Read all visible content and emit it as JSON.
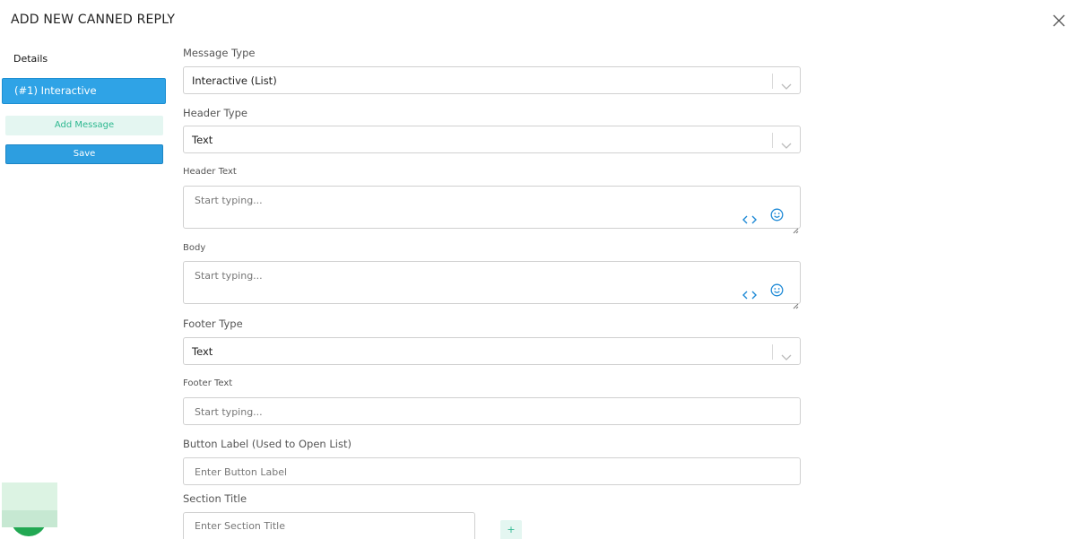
{
  "dialog": {
    "title": "ADD NEW CANNED REPLY"
  },
  "sidebar": {
    "details_label": "Details",
    "active_item": "(#1) Interactive",
    "add_message": "Add Message",
    "save": "Save"
  },
  "form": {
    "message_type": {
      "label": "Message Type",
      "value": "Interactive (List)"
    },
    "header_type": {
      "label": "Header Type",
      "value": "Text"
    },
    "header_text": {
      "label": "Header Text",
      "placeholder": "Start typing..."
    },
    "body": {
      "label": "Body",
      "placeholder": "Start typing..."
    },
    "footer_type": {
      "label": "Footer Type",
      "value": "Text"
    },
    "footer_text": {
      "label": "Footer Text",
      "placeholder": "Start typing..."
    },
    "button_label": {
      "label": "Button Label (Used to Open List)",
      "placeholder": "Enter Button Label"
    },
    "section_title": {
      "label": "Section Title",
      "placeholder": "Enter Section Title"
    },
    "add_section_symbol": "+"
  },
  "icons": {
    "close": "close-icon",
    "chevron": "chevron-down-icon",
    "code": "code-icon",
    "emoji": "emoji-icon"
  },
  "colors": {
    "primary": "#2fa3e6",
    "accent_green": "#2eb890",
    "light_green_bg": "#e4f6f1",
    "icon_blue": "#1f8ad6"
  }
}
